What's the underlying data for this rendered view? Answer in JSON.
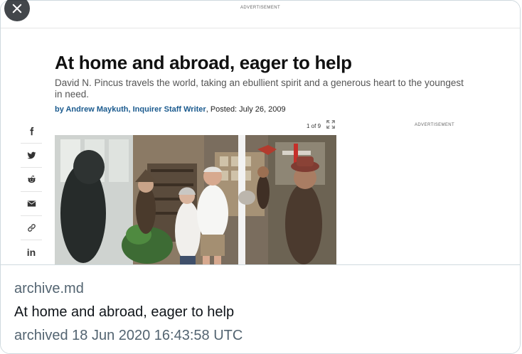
{
  "preview": {
    "top_ad_label": "ADVERTISEMENT",
    "side_ad_label": "ADVERTISEMENT",
    "headline": "At home and abroad, eager to help",
    "subhead": "David N. Pincus travels the world, taking an ebullient spirit and a generous heart to the youngest in need.",
    "byline": {
      "author": "by Andrew Maykuth, Inquirer Staff Writer",
      "posted": ", Posted: July 26, 2009"
    },
    "gallery": {
      "counter": "1 of 9"
    },
    "social": [
      {
        "icon": "facebook-icon"
      },
      {
        "icon": "twitter-icon"
      },
      {
        "icon": "reddit-icon"
      },
      {
        "icon": "email-icon"
      },
      {
        "icon": "link-icon"
      },
      {
        "icon": "linkedin-icon",
        "text": "in"
      }
    ]
  },
  "card": {
    "domain": "archive.md",
    "title": "At home and abroad, eager to help",
    "archived": "archived 18 Jun 2020 16:43:58 UTC"
  },
  "colors": {
    "author_link": "#1a5a8e",
    "meta_secondary": "#536471",
    "meta_primary": "#0f1419",
    "card_border": "#cfd9de"
  }
}
